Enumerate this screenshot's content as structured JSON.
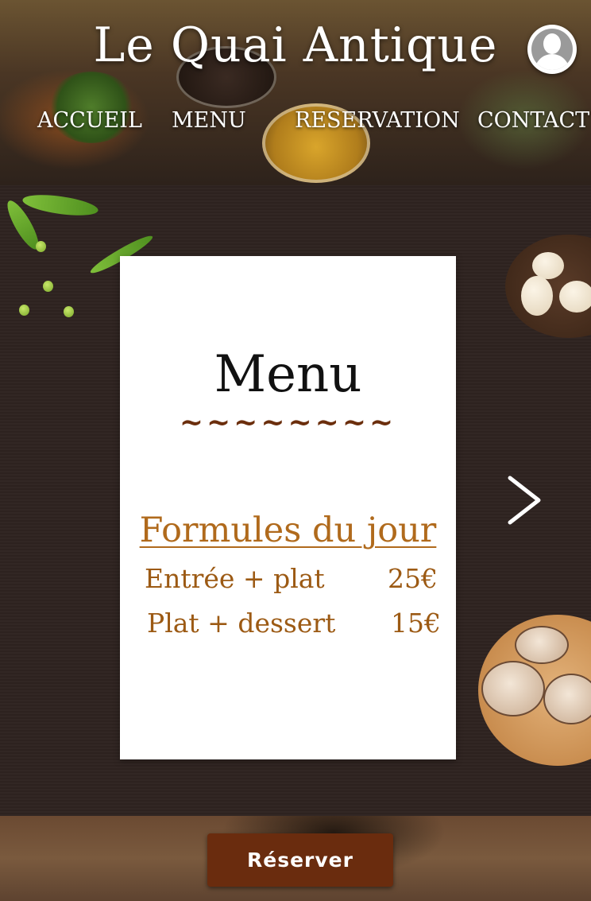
{
  "header": {
    "brand": "Le Quai Antique",
    "nav": [
      {
        "label": "ACCUEIL"
      },
      {
        "label": "MENU"
      },
      {
        "label": "RESERVATION"
      },
      {
        "label": "CONTACT"
      }
    ],
    "account_icon": "user-avatar-icon"
  },
  "menu_card": {
    "title": "Menu",
    "divider": "~~~~~~~~",
    "section_title": "Formules du jour",
    "items": [
      {
        "name": "Entrée + plat",
        "price": "25€"
      },
      {
        "name": "Plat + dessert",
        "price": "15€"
      }
    ]
  },
  "carousel": {
    "next_icon": "chevron-right-icon"
  },
  "footer": {
    "reserve_label": "Réserver"
  },
  "colors": {
    "accent_brown": "#6a2c0e",
    "menu_gold": "#b06a1c",
    "background_dark": "#2e2320",
    "card_bg": "#ffffff"
  }
}
